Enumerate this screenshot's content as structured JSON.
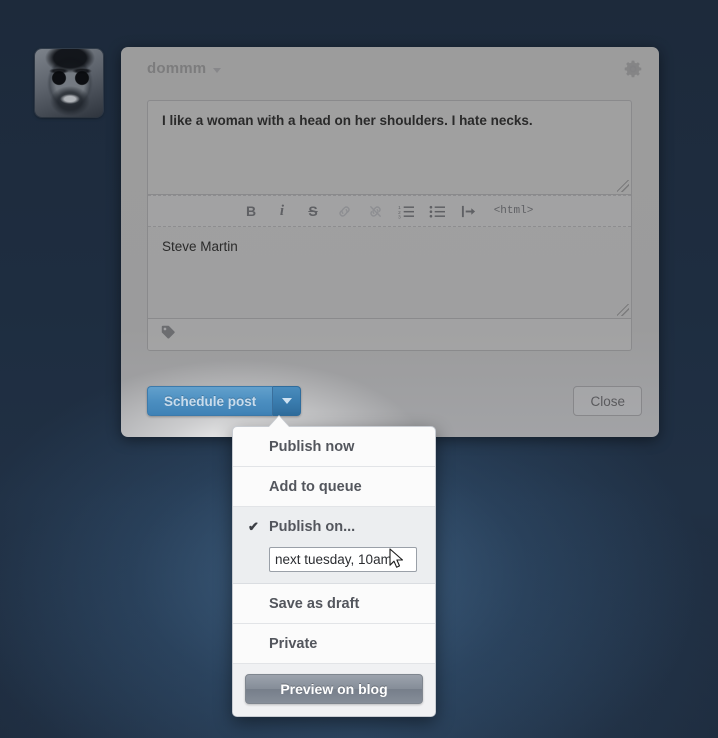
{
  "window": {
    "background_color": "#1e2c3e",
    "glow_color": "#5684af"
  },
  "avatar": {
    "alt": "user avatar photo"
  },
  "post_modal": {
    "blog_name": "dommm",
    "settings_icon": "gear-icon",
    "quote_text": "I like a woman with a head on her shoulders. I hate necks.",
    "source_text": "Steve Martin",
    "toolbar": [
      {
        "name": "bold-icon",
        "label": "B",
        "dim": false
      },
      {
        "name": "italic-icon",
        "label": "i",
        "dim": false
      },
      {
        "name": "strikethrough-icon",
        "label": "S",
        "dim": false
      },
      {
        "name": "link-icon",
        "label": "link",
        "dim": true
      },
      {
        "name": "unlink-icon",
        "label": "unlink",
        "dim": true
      },
      {
        "name": "ordered-list-icon",
        "label": "ordered list",
        "dim": false
      },
      {
        "name": "unordered-list-icon",
        "label": "bullet list",
        "dim": false
      },
      {
        "name": "indent-icon",
        "label": "indent",
        "dim": false
      },
      {
        "name": "html-toggle",
        "label": "<html>",
        "dim": false
      }
    ],
    "tag_icon": "tag-icon",
    "footer": {
      "primary_label": "Schedule post",
      "primary_color": "#4b8ec0",
      "dropdown_caret": "chevron-down-icon",
      "close_label": "Close"
    }
  },
  "dropdown": {
    "items": [
      {
        "label": "Publish now",
        "checked": false
      },
      {
        "label": "Add to queue",
        "checked": false
      },
      {
        "label": "Publish on...",
        "checked": true
      },
      {
        "label": "Save as draft",
        "checked": false
      },
      {
        "label": "Private",
        "checked": false
      }
    ],
    "publish_on_value": "next tuesday, 10am",
    "publish_on_placeholder": "",
    "preview_label": "Preview on blog",
    "check_glyph": "✔"
  }
}
